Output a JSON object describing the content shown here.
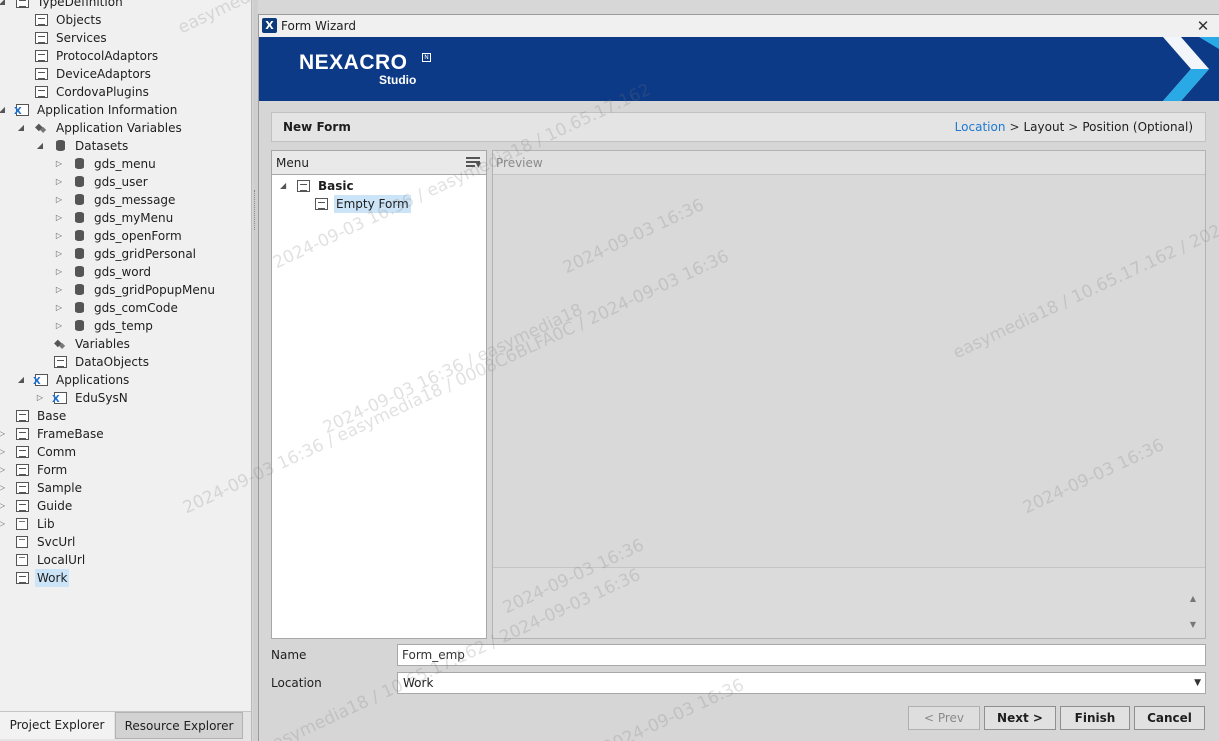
{
  "explorer": {
    "tree": [
      {
        "label": "TypeDefinition",
        "level": 0,
        "toggle": "expanded",
        "icon": "typedef-icon"
      },
      {
        "label": "Objects",
        "level": 1,
        "toggle": "none",
        "icon": "objects-icon"
      },
      {
        "label": "Services",
        "level": 1,
        "toggle": "none",
        "icon": "services-icon"
      },
      {
        "label": "ProtocolAdaptors",
        "level": 1,
        "toggle": "none",
        "icon": "protocol-adaptors-icon"
      },
      {
        "label": "DeviceAdaptors",
        "level": 1,
        "toggle": "none",
        "icon": "device-adaptors-icon"
      },
      {
        "label": "CordovaPlugins",
        "level": 1,
        "toggle": "none",
        "icon": "cordova-plugins-icon"
      },
      {
        "label": "Application Information",
        "level": 0,
        "toggle": "expanded",
        "icon": "app-info-icon"
      },
      {
        "label": "Application Variables",
        "level": 1,
        "toggle": "expanded",
        "icon": "variables-icon"
      },
      {
        "label": "Datasets",
        "level": 2,
        "toggle": "expanded",
        "icon": "datasets-icon"
      },
      {
        "label": "gds_menu",
        "level": 3,
        "toggle": "collapsed",
        "icon": "dataset-icon"
      },
      {
        "label": "gds_user",
        "level": 3,
        "toggle": "collapsed",
        "icon": "dataset-icon"
      },
      {
        "label": "gds_message",
        "level": 3,
        "toggle": "collapsed",
        "icon": "dataset-icon"
      },
      {
        "label": "gds_myMenu",
        "level": 3,
        "toggle": "collapsed",
        "icon": "dataset-icon"
      },
      {
        "label": "gds_openForm",
        "level": 3,
        "toggle": "collapsed",
        "icon": "dataset-icon"
      },
      {
        "label": "gds_gridPersonal",
        "level": 3,
        "toggle": "collapsed",
        "icon": "dataset-icon"
      },
      {
        "label": "gds_word",
        "level": 3,
        "toggle": "collapsed",
        "icon": "dataset-icon"
      },
      {
        "label": "gds_gridPopupMenu",
        "level": 3,
        "toggle": "collapsed",
        "icon": "dataset-icon"
      },
      {
        "label": "gds_comCode",
        "level": 3,
        "toggle": "collapsed",
        "icon": "dataset-icon"
      },
      {
        "label": "gds_temp",
        "level": 3,
        "toggle": "collapsed",
        "icon": "dataset-icon"
      },
      {
        "label": "Variables",
        "level": 2,
        "toggle": "none",
        "icon": "variables-icon"
      },
      {
        "label": "DataObjects",
        "level": 2,
        "toggle": "none",
        "icon": "dataobjects-icon"
      },
      {
        "label": "Applications",
        "level": 1,
        "toggle": "expanded",
        "icon": "applications-icon"
      },
      {
        "label": "EduSysN",
        "level": 2,
        "toggle": "collapsed",
        "icon": "application-icon"
      },
      {
        "label": "Base",
        "level": 0,
        "toggle": "none",
        "icon": "form-folder-icon"
      },
      {
        "label": "FrameBase",
        "level": 0,
        "toggle": "collapsed",
        "icon": "form-folder-icon"
      },
      {
        "label": "Comm",
        "level": 0,
        "toggle": "collapsed",
        "icon": "form-folder-icon"
      },
      {
        "label": "Form",
        "level": 0,
        "toggle": "collapsed",
        "icon": "form-folder-icon"
      },
      {
        "label": "Sample",
        "level": 0,
        "toggle": "collapsed",
        "icon": "form-folder-icon"
      },
      {
        "label": "Guide",
        "level": 0,
        "toggle": "collapsed",
        "icon": "form-folder-icon"
      },
      {
        "label": "Lib",
        "level": 0,
        "toggle": "collapsed",
        "icon": "lib-folder-icon"
      },
      {
        "label": "SvcUrl",
        "level": 0,
        "toggle": "none",
        "icon": "url-icon"
      },
      {
        "label": "LocalUrl",
        "level": 0,
        "toggle": "none",
        "icon": "url-icon"
      },
      {
        "label": "Work",
        "level": 0,
        "toggle": "none",
        "icon": "form-folder-icon",
        "selected": true
      }
    ],
    "tabs": {
      "project": "Project Explorer",
      "resource": "Resource Explorer"
    }
  },
  "dialog": {
    "title": "Form Wizard",
    "close_glyph": "✕",
    "logo": {
      "name": "NEXACRO",
      "badge": "N",
      "sub": "Studio"
    },
    "step_title": "New Form",
    "steps": [
      "Location",
      "Layout",
      "Position (Optional)"
    ],
    "step_separator": ">",
    "menu": {
      "title": "Menu",
      "items": [
        {
          "label": "Basic",
          "level": 0,
          "toggle": "expanded",
          "bold": true
        },
        {
          "label": "Empty Form",
          "level": 1,
          "toggle": "none",
          "selected": true
        }
      ]
    },
    "preview": {
      "title": "Preview"
    },
    "fields": {
      "name_label": "Name",
      "name_value": "Form_emp",
      "location_label": "Location",
      "location_value": "Work"
    },
    "buttons": {
      "prev": "< Prev",
      "next": "Next >",
      "finish": "Finish",
      "cancel": "Cancel"
    },
    "colors": {
      "banner": "#0d3a86",
      "accent": "#1f78d1",
      "selection": "#cce4f7"
    }
  },
  "watermark": {
    "texts": [
      "2024-09-03 16:36 / easymedia18 / 0008C6BLFA0C / 2024-09-03 16:36",
      "2024-09-03 16:36 / easymedia18 / 10.65.17.162",
      "easymedia18 / 10.65.17.162 / 2024-09-03 16:36",
      "2024-09-03 16:36 / easymedia18",
      "2024-09-03 16:36"
    ]
  }
}
